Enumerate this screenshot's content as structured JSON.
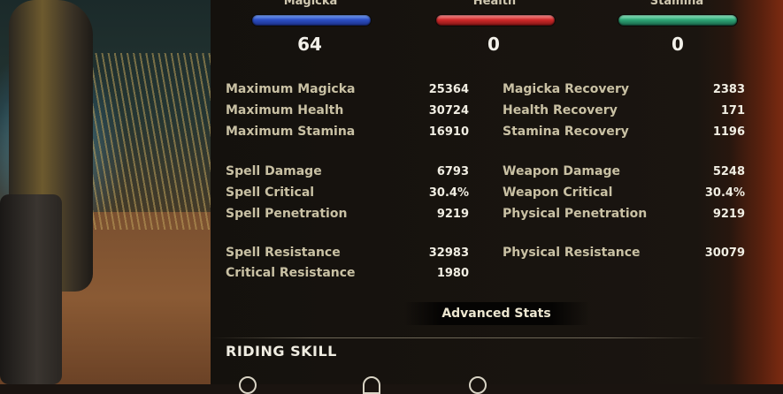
{
  "resources": [
    {
      "name": "Magicka",
      "value": "64"
    },
    {
      "name": "Health",
      "value": "0"
    },
    {
      "name": "Stamina",
      "value": "0"
    }
  ],
  "stats": {
    "group1": [
      {
        "left_label": "Maximum Magicka",
        "left_value": "25364",
        "right_label": "Magicka Recovery",
        "right_value": "2383"
      },
      {
        "left_label": "Maximum Health",
        "left_value": "30724",
        "right_label": "Health Recovery",
        "right_value": "171"
      },
      {
        "left_label": "Maximum Stamina",
        "left_value": "16910",
        "right_label": "Stamina Recovery",
        "right_value": "1196"
      }
    ],
    "group2": [
      {
        "left_label": "Spell Damage",
        "left_value": "6793",
        "right_label": "Weapon Damage",
        "right_value": "5248"
      },
      {
        "left_label": "Spell Critical",
        "left_value": "30.4%",
        "right_label": "Weapon Critical",
        "right_value": "30.4%"
      },
      {
        "left_label": "Spell Penetration",
        "left_value": "9219",
        "right_label": "Physical Penetration",
        "right_value": "9219"
      }
    ],
    "group3": [
      {
        "left_label": "Spell Resistance",
        "left_value": "32983",
        "right_label": "Physical Resistance",
        "right_value": "30079"
      },
      {
        "left_label": "Critical Resistance",
        "left_value": "1980",
        "right_label": "",
        "right_value": ""
      }
    ]
  },
  "advanced_button": "Advanced Stats",
  "riding_title": "RIDING SKILL",
  "colors": {
    "magicka": "#2c4fc4",
    "health": "#d02a2a",
    "stamina": "#2fa777"
  }
}
